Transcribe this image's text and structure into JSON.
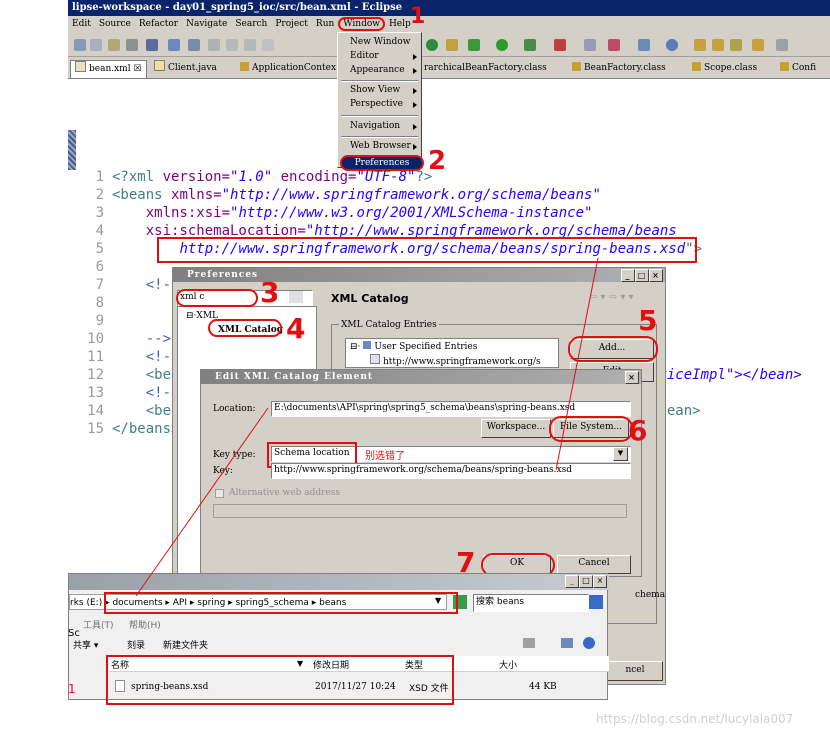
{
  "window": {
    "title": "lipse-workspace - day01_spring5_ioc/src/bean.xml - Eclipse"
  },
  "menubar": [
    "Edit",
    "Source",
    "Refactor",
    "Navigate",
    "Search",
    "Project",
    "Run",
    "Window",
    "Help"
  ],
  "tabs": [
    "bean.xml",
    "Client.java",
    "ApplicationContex",
    "rarchicalBeanFactory.class",
    "BeanFactory.class",
    "Scope.class",
    "Confi"
  ],
  "code": {
    "line_numbers": [
      "1",
      "2",
      "3",
      "4",
      "5",
      "6",
      "7",
      "8",
      "9",
      "10",
      "11",
      "12",
      "13",
      "14",
      "15"
    ],
    "l1": {
      "a": "<?xml ",
      "b": "version=",
      "c": "\"1.0\"",
      "d": " encoding=",
      "e": "\"UTF-8\"",
      "f": "?>"
    },
    "l2": {
      "a": "<beans ",
      "b": "xmlns=",
      "c": "\"http://www.springframework.org/schema/beans\""
    },
    "l3": {
      "b": "xmlns:xsi=",
      "c": "\"http://www.w3.org/2001/XMLSchema-instance\""
    },
    "l4": {
      "b": "xsi:schemaLocation=",
      "c": "\"http://www.springframework.org/schema/beans"
    },
    "l5": {
      "c": "http://www.springframework.org/schema/beans/spring-beans.xsd",
      "d": "\">"
    },
    "l7": "<!--",
    "l10": "-->",
    "l11": "<!--",
    "l12": "<bea",
    "l12_tail": "rviceImpl\"></bean>",
    "l13": "<!--",
    "l14": "<bea",
    "l14_tail": "/bean>",
    "l15": "</beans>"
  },
  "window_menu": {
    "items": [
      "New Window",
      "Editor",
      "Appearance",
      "Show View",
      "Perspective",
      "Navigation",
      "Web Browser",
      "Preferences"
    ]
  },
  "preferences": {
    "title": "Preferences",
    "filter_value": "xml c",
    "tree": [
      "XML",
      "XML Catalog"
    ],
    "page_title": "XML Catalog",
    "group_label": "XML Catalog Entries",
    "entries": [
      "User Specified Entries",
      "http://www.springframework.org/s"
    ],
    "add_button": "Add...",
    "edit_button": "Edit",
    "right_fragment": "chema",
    "cancel_fragment": "ncel"
  },
  "edit_dialog": {
    "title": "Edit XML Catalog Element",
    "location_label": "Location:",
    "location_value": "E:\\documents\\API\\spring\\spring5_schema\\beans\\spring-beans.xsd",
    "workspace_button": "Workspace...",
    "filesystem_button": "File System...",
    "key_type_label": "Key type:",
    "key_type_value": "Schema location",
    "key_type_note": "别选错了",
    "key_label": "Key:",
    "key_value": "http://www.springframework.org/schema/beans/spring-beans.xsd",
    "alt_checkbox": "Alternative web address",
    "ok_button": "OK",
    "cancel_button": "Cancel"
  },
  "explorer": {
    "address": "rks (E:) ▸ documents ▸ API ▸ spring ▸ spring5_schema ▸ beans",
    "search_placeholder": "搜索 beans",
    "menu": [
      "工具(T)",
      "帮助(H)"
    ],
    "toolbar": [
      "共享 ▾",
      "刻录",
      "新建文件夹"
    ],
    "columns": [
      "名称",
      "修改日期",
      "类型",
      "大小"
    ],
    "rows": [
      {
        "name": "spring-beans.xsd",
        "date": "2017/11/27 10:24",
        "type": "XSD 文件",
        "size": "44 KB"
      }
    ],
    "left_fragments": [
      "Sc",
      "1"
    ]
  },
  "annotations": [
    "1",
    "2",
    "3",
    "4",
    "5",
    "6",
    "7"
  ],
  "watermark": "https://blog.csdn.net/lucylala007"
}
